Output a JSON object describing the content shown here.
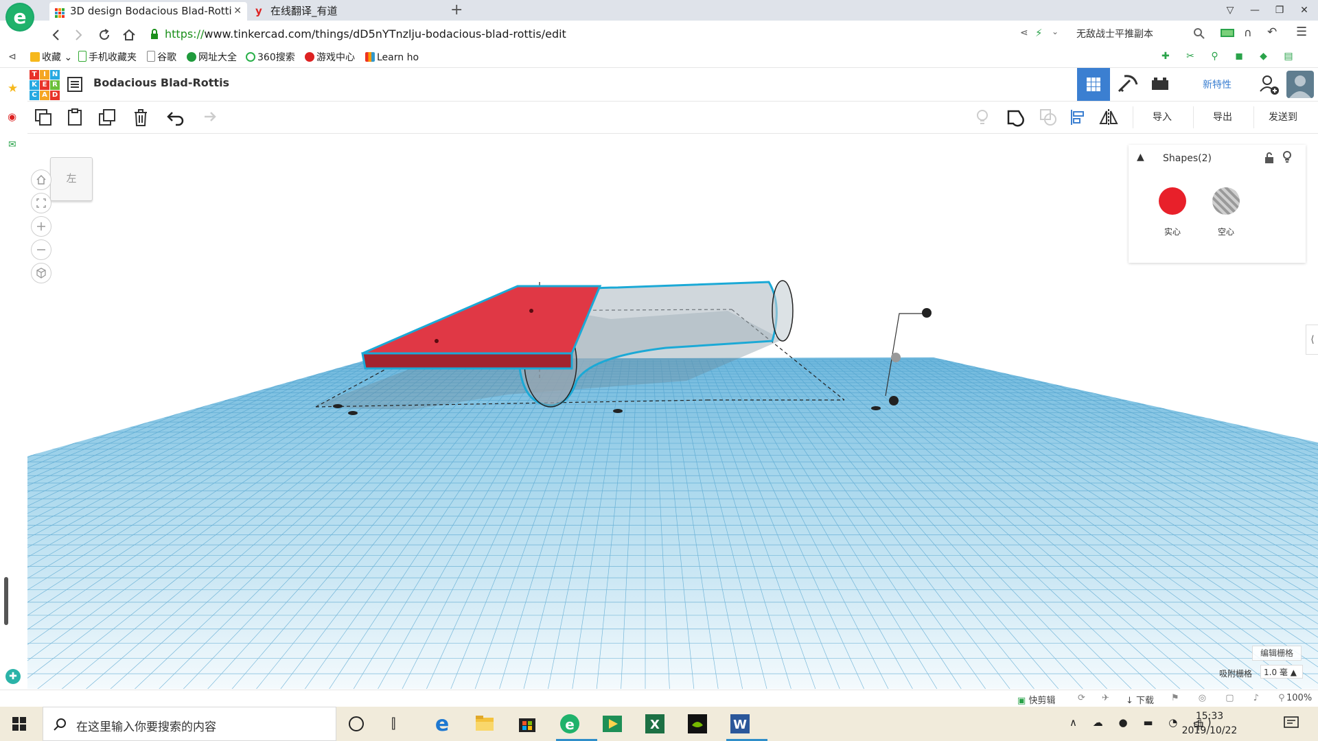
{
  "browser": {
    "tabs": [
      {
        "title": "3D design Bodacious Blad-Rotti",
        "active": true
      },
      {
        "title": "在线翻译_有道",
        "active": false
      }
    ],
    "new_tab_symbol": "+",
    "url_protocol": "https://",
    "url_rest": "www.tinkercad.com/things/dD5nYTnzlju-bodacious-blad-rottis/edit",
    "search_text": "无敌战士平推副本",
    "bookmarks": [
      "收藏",
      "手机收藏夹",
      "谷歌",
      "网址大全",
      "360搜索",
      "游戏中心",
      "Learn ho"
    ]
  },
  "app": {
    "logo_letters": [
      "T",
      "I",
      "N",
      "K",
      "E",
      "R",
      "C",
      "A",
      "D"
    ],
    "design_title": "Bodacious Blad-Rottis",
    "new_features": "新特性",
    "toolbar_right": {
      "import": "导入",
      "export": "导出",
      "send_to": "发送到"
    }
  },
  "workplane": {
    "view_cube_label": "左",
    "shapes_panel": {
      "title": "Shapes(2)",
      "solid_label": "实心",
      "hole_label": "空心",
      "solid_color": "#e8202a"
    },
    "edit_grid": "编辑栅格",
    "snap_grid_label": "吸附栅格",
    "snap_grid_value": "1.0 毫 ▲"
  },
  "statusbar": {
    "quick_clip": "快剪辑",
    "download": "下载",
    "zoom": "100%"
  },
  "taskbar": {
    "search_placeholder": "在这里输入你要搜索的内容",
    "ime": "中",
    "time": "15:33",
    "date": "2019/10/22"
  },
  "colors": {
    "accent_blue": "#3b7fd1",
    "grid_blue": "#8cc8e2",
    "shape_red": "#e03845"
  }
}
